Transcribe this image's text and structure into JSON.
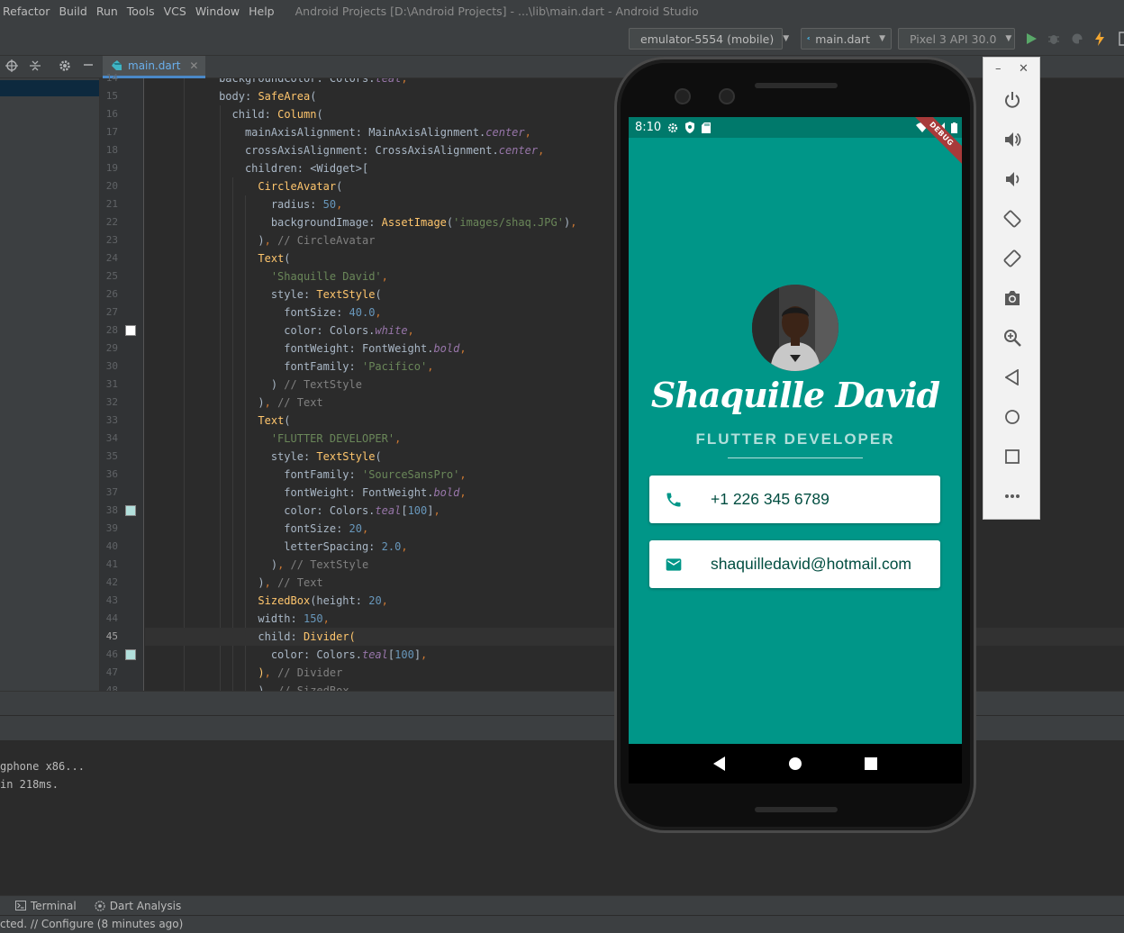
{
  "menu": [
    "Refactor",
    "Build",
    "Run",
    "Tools",
    "VCS",
    "Window",
    "Help"
  ],
  "window_title": "Android Projects [D:\\Android Projects] - ...\\lib\\main.dart - Android Studio",
  "toolbar": {
    "device_combo": "emulator-5554 (mobile)",
    "config_combo": "main.dart",
    "avd_combo": "Pixel 3 API 30.0"
  },
  "editor_tab": {
    "label": "main.dart"
  },
  "code_lines": [
    {
      "no": "14",
      "html": "<span class=\"t-id\">backgroundColor: Colors.</span><span class=\"t-it\">teal</span><span class=\"t-kw\">,</span>"
    },
    {
      "no": "15",
      "html": "<span class=\"t-id\">body: </span><span class=\"t-fn\">SafeArea</span><span class=\"t-id\">(</span>"
    },
    {
      "no": "16",
      "html": "<span class=\"t-id\">child: </span><span class=\"t-fn\">Column</span><span class=\"t-id\">(</span>"
    },
    {
      "no": "17",
      "html": "<span class=\"t-id\">mainAxisAlignment: MainAxisAlignment.</span><span class=\"t-it\">center</span><span class=\"t-kw\">,</span>"
    },
    {
      "no": "18",
      "html": "<span class=\"t-id\">crossAxisAlignment: CrossAxisAlignment.</span><span class=\"t-it\">center</span><span class=\"t-kw\">,</span>"
    },
    {
      "no": "19",
      "html": "<span class=\"t-id\">children: &lt;Widget&gt;[</span>"
    },
    {
      "no": "20",
      "html": "<span class=\"t-fn\">CircleAvatar</span><span class=\"t-id\">(</span>"
    },
    {
      "no": "21",
      "html": "<span class=\"t-id\">radius: </span><span class=\"t-num\">50</span><span class=\"t-kw\">,</span>"
    },
    {
      "no": "22",
      "html": "<span class=\"t-id\">backgroundImage: </span><span class=\"t-fn\">AssetImage</span><span class=\"t-id\">(</span><span class=\"t-str\">'images/shaq.JPG'</span><span class=\"t-id\">)</span><span class=\"t-kw\">,</span>"
    },
    {
      "no": "23",
      "html": "<span class=\"t-id\">)</span><span class=\"t-kw\">, </span><span class=\"t-com\">// CircleAvatar</span>"
    },
    {
      "no": "24",
      "html": "<span class=\"t-fn\">Text</span><span class=\"t-id\">(</span>"
    },
    {
      "no": "25",
      "html": "<span class=\"t-str\">'Shaquille David'</span><span class=\"t-kw\">,</span>"
    },
    {
      "no": "26",
      "html": "<span class=\"t-id\">style: </span><span class=\"t-fn\">TextStyle</span><span class=\"t-id\">(</span>"
    },
    {
      "no": "27",
      "html": "<span class=\"t-id\">fontSize: </span><span class=\"t-num\">40.0</span><span class=\"t-kw\">,</span>"
    },
    {
      "no": "28",
      "html": "<span class=\"t-id\">color: Colors.</span><span class=\"t-it\">white</span><span class=\"t-kw\">,</span>"
    },
    {
      "no": "29",
      "html": "<span class=\"t-id\">fontWeight: FontWeight.</span><span class=\"t-it\">bold</span><span class=\"t-kw\">,</span>"
    },
    {
      "no": "30",
      "html": "<span class=\"t-id\">fontFamily: </span><span class=\"t-str\">'Pacifico'</span><span class=\"t-kw\">,</span>"
    },
    {
      "no": "31",
      "html": "<span class=\"t-id\">) </span><span class=\"t-com\">// TextStyle</span>"
    },
    {
      "no": "32",
      "html": "<span class=\"t-id\">)</span><span class=\"t-kw\">, </span><span class=\"t-com\">// Text</span>"
    },
    {
      "no": "33",
      "html": "<span class=\"t-fn\">Text</span><span class=\"t-id\">(</span>"
    },
    {
      "no": "34",
      "html": "<span class=\"t-str\">'FLUTTER DEVELOPER'</span><span class=\"t-kw\">,</span>"
    },
    {
      "no": "35",
      "html": "<span class=\"t-id\">style: </span><span class=\"t-fn\">TextStyle</span><span class=\"t-id\">(</span>"
    },
    {
      "no": "36",
      "html": "<span class=\"t-id\">fontFamily: </span><span class=\"t-str\">'SourceSansPro'</span><span class=\"t-kw\">,</span>"
    },
    {
      "no": "37",
      "html": "<span class=\"t-id\">fontWeight: FontWeight.</span><span class=\"t-it\">bold</span><span class=\"t-kw\">,</span>"
    },
    {
      "no": "38",
      "html": "<span class=\"t-id\">color: Colors.</span><span class=\"t-it\">teal</span><span class=\"t-id\">[</span><span class=\"t-num\">100</span><span class=\"t-id\">]</span><span class=\"t-kw\">,</span>"
    },
    {
      "no": "39",
      "html": "<span class=\"t-id\">fontSize: </span><span class=\"t-num\">20</span><span class=\"t-kw\">,</span>"
    },
    {
      "no": "40",
      "html": "<span class=\"t-id\">letterSpacing: </span><span class=\"t-num\">2.0</span><span class=\"t-kw\">,</span>"
    },
    {
      "no": "41",
      "html": "<span class=\"t-id\">)</span><span class=\"t-kw\">, </span><span class=\"t-com\">// TextStyle</span>"
    },
    {
      "no": "42",
      "html": "<span class=\"t-id\">)</span><span class=\"t-kw\">, </span><span class=\"t-com\">// Text</span>"
    },
    {
      "no": "43",
      "html": "<span class=\"t-fn\">SizedBox</span><span class=\"t-id\">(height: </span><span class=\"t-num\">20</span><span class=\"t-kw\">,</span>"
    },
    {
      "no": "44",
      "html": "<span class=\"t-id\">width: </span><span class=\"t-num\">150</span><span class=\"t-kw\">,</span>"
    },
    {
      "no": "45",
      "html": "<span class=\"t-id\">child: </span><span class=\"t-fn\">Divider</span><span class=\"t-fn\">(</span>"
    },
    {
      "no": "46",
      "html": "<span class=\"t-id\">color: Colors.</span><span class=\"t-it\">teal</span><span class=\"t-id\">[</span><span class=\"t-num\">100</span><span class=\"t-id\">]</span><span class=\"t-kw\">,</span>"
    },
    {
      "no": "47",
      "html": "<span class=\"t-fn\">)</span><span class=\"t-kw\">, </span><span class=\"t-com\">// Divider</span>"
    },
    {
      "no": "48",
      "html": "<span class=\"t-id\">)</span><span class=\"t-kw\">, </span><span class=\"t-com\">// SizedBox</span>"
    }
  ],
  "console": [
    "gphone x86...",
    "in 218ms."
  ],
  "tool_windows": [
    "Terminal",
    "Dart Analysis"
  ],
  "status_text": "cted. // Configure (8 minutes ago)",
  "phone": {
    "time": "8:10",
    "debug_banner": "DEBUG",
    "name": "Shaquille David",
    "title": "FLUTTER DEVELOPER",
    "phone_number": "+1 226 345 6789",
    "email": "shaquilledavid@hotmail.com"
  },
  "emulator_controls": [
    "power-icon",
    "volume-up-icon",
    "volume-down-icon",
    "rotate-left-icon",
    "rotate-right-icon",
    "camera-icon",
    "zoom-icon",
    "back-icon",
    "home-icon",
    "overview-icon",
    "more-icon"
  ],
  "colors": {
    "app_background": "#009688",
    "status_bar": "#00796b",
    "subtitle": "#b2dfdb",
    "card_text": "#004d40",
    "ide_background": "#2b2b2b"
  }
}
